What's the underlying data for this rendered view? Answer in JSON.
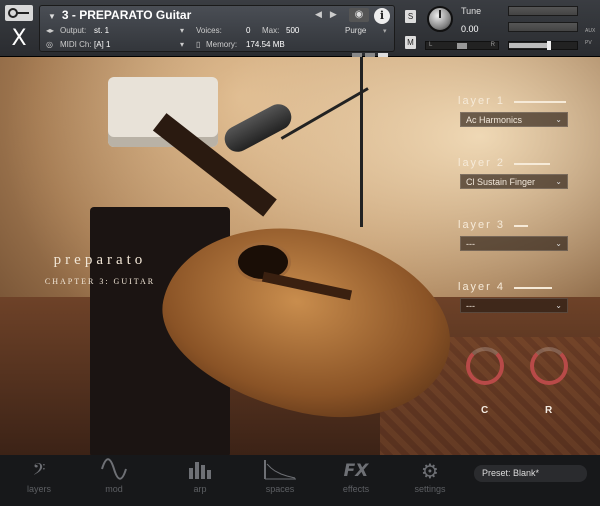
{
  "header": {
    "instrument_title": "3 - PREPARATO Guitar",
    "output_label": "Output:",
    "output_value": "st. 1",
    "voices_label": "Voices:",
    "voices_value": "0",
    "max_label": "Max:",
    "max_value": "500",
    "midi_label": "MIDI Ch:",
    "midi_value": "[A]  1",
    "memory_label": "Memory:",
    "memory_value": "174.54 MB",
    "purge_label": "Purge",
    "solo_label": "S",
    "mute_label": "M",
    "tune_label": "Tune",
    "tune_value": "0.00",
    "pan_left": "L",
    "pan_right": "R",
    "aux_label": "AUX",
    "pv_label": "PV"
  },
  "brand": {
    "name": "preparato",
    "subtitle": "CHAPTER 3: GUITAR"
  },
  "layers": [
    {
      "title": "layer 1",
      "value": "Ac Harmonics"
    },
    {
      "title": "layer 2",
      "value": "Cl Sustain Finger"
    },
    {
      "title": "layer 3",
      "value": "---"
    },
    {
      "title": "layer 4",
      "value": "---"
    }
  ],
  "knobs": [
    {
      "label": "C"
    },
    {
      "label": "R"
    }
  ],
  "bottom_nav": [
    {
      "label": "layers",
      "icon": "bass-clef-icon"
    },
    {
      "label": "mod",
      "icon": "sine-wave-icon"
    },
    {
      "label": "arp",
      "icon": "bars-icon"
    },
    {
      "label": "spaces",
      "icon": "spectrum-icon"
    },
    {
      "label": "effects",
      "icon": "fx-icon",
      "glyph": "FX"
    },
    {
      "label": "settings",
      "icon": "gears-icon"
    }
  ],
  "preset": "Preset: Blank*",
  "colors": {
    "knob_ring": "#b84a48",
    "nav_text": "#5d5f63",
    "header_bg": "#2a2c30"
  }
}
